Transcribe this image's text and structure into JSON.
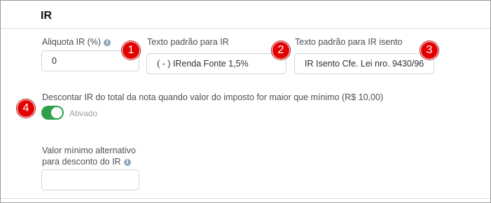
{
  "section": {
    "title": "IR"
  },
  "fields": {
    "aliquota": {
      "label": "Aliquota IR (%)",
      "value": "0"
    },
    "texto_padrao": {
      "label": "Texto padrão para IR",
      "value": "( - ) IRenda Fonte 1,5%"
    },
    "texto_isento": {
      "label": "Texto padrão para IR isento",
      "value": "IR Isento Cfe. Lei nro. 9430/96"
    },
    "descontar": {
      "label": "Descontar IR do total da nota quando valor do imposto for maior que mínimo (R$ 10,00)",
      "toggle_label": "Ativado",
      "enabled": true
    },
    "valor_minimo": {
      "label_line1": "Valor mínimo alternativo",
      "label_line2": "para desconto do IR",
      "value": ""
    }
  },
  "info_icon_glyph": "i",
  "callouts": [
    "1",
    "2",
    "3",
    "4"
  ],
  "colors": {
    "toggle_on": "#2ea04a",
    "callout": "#e30000",
    "info_icon": "#8fa7bd"
  }
}
